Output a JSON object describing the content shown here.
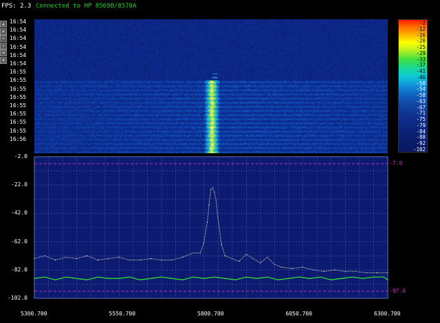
{
  "header": {
    "fps": "FPS: 2.3",
    "connection": "Connected to HP 8569B/8570A"
  },
  "nav_buttons": [
    {
      "glyph": "▴",
      "icon": "up-icon"
    },
    {
      "glyph": "«",
      "icon": "double-left-icon"
    },
    {
      "glyph": "‹",
      "icon": "left-icon"
    },
    {
      "glyph": "›",
      "icon": "right-icon"
    },
    {
      "glyph": "»",
      "icon": "double-right-icon"
    },
    {
      "glyph": "▾",
      "icon": "down-icon"
    }
  ],
  "waterfall": {
    "time_labels": [
      "16:54",
      "16:54",
      "16:54",
      "16:54",
      "16:54",
      "16:54",
      "16:55",
      "16:55",
      "16:55",
      "16:55",
      "16:55",
      "16:55",
      "16:55",
      "16:55",
      "16:56"
    ]
  },
  "colorbar": {
    "labels": [
      "-2",
      "-12",
      "-16",
      "-20",
      "-25",
      "-29",
      "-33",
      "-37",
      "-41",
      "-46",
      "-50",
      "-54",
      "-58",
      "-63",
      "-67",
      "-71",
      "-75",
      "-79",
      "-84",
      "-88",
      "-92",
      "-102"
    ]
  },
  "chart_data": {
    "type": "line",
    "x_ticks": [
      "5300.700",
      "5550.700",
      "5800.700",
      "6050.700",
      "6300.700"
    ],
    "y_ticks": [
      "-2.0",
      "-22.0",
      "-42.0",
      "-62.0",
      "-82.0",
      "-102.0"
    ],
    "xlim": [
      5300.7,
      6300.7
    ],
    "ylim": [
      -102,
      -2
    ],
    "grid": true,
    "reference_lines": [
      {
        "value": -7.0,
        "label": "-7.0"
      },
      {
        "value": -97.0,
        "label": "-97.0"
      }
    ],
    "series": [
      {
        "color": "#e8e0c0",
        "style": "dotted",
        "x": [
          5300.7,
          5330,
          5360,
          5390,
          5420,
          5450,
          5480,
          5510,
          5540,
          5570,
          5600,
          5630,
          5660,
          5690,
          5720,
          5750,
          5770,
          5780,
          5790,
          5795,
          5800,
          5805,
          5810,
          5815,
          5820,
          5830,
          5840,
          5860,
          5880,
          5900,
          5920,
          5940,
          5960,
          5980,
          6000,
          6030,
          6060,
          6090,
          6120,
          6150,
          6180,
          6210,
          6240,
          6270,
          6300.7
        ],
        "values": [
          -74,
          -72,
          -75,
          -73,
          -74,
          -72,
          -75,
          -74,
          -73,
          -75,
          -75,
          -74,
          -75,
          -75,
          -73,
          -70,
          -70,
          -63,
          -48,
          -36,
          -25,
          -24,
          -27,
          -33,
          -45,
          -64,
          -72,
          -74,
          -76,
          -71,
          -74,
          -77,
          -73,
          -78,
          -80,
          -81,
          -80,
          -82,
          -83,
          -82,
          -83,
          -83,
          -84,
          -84,
          -84
        ]
      },
      {
        "color": "#30e030",
        "style": "solid",
        "x": [
          5300.7,
          5330,
          5360,
          5390,
          5420,
          5450,
          5480,
          5510,
          5540,
          5570,
          5600,
          5630,
          5660,
          5690,
          5720,
          5750,
          5780,
          5810,
          5840,
          5870,
          5900,
          5930,
          5960,
          5990,
          6020,
          6050,
          6080,
          6110,
          6140,
          6170,
          6200,
          6230,
          6260,
          6290,
          6300.7
        ],
        "values": [
          -88,
          -87,
          -89,
          -87,
          -88,
          -89,
          -87,
          -88,
          -88,
          -87,
          -89,
          -88,
          -87,
          -88,
          -89,
          -87,
          -88,
          -87,
          -88,
          -89,
          -87,
          -88,
          -87,
          -89,
          -88,
          -87,
          -88,
          -87,
          -89,
          -88,
          -87,
          -88,
          -87,
          -87,
          -89
        ]
      }
    ]
  }
}
